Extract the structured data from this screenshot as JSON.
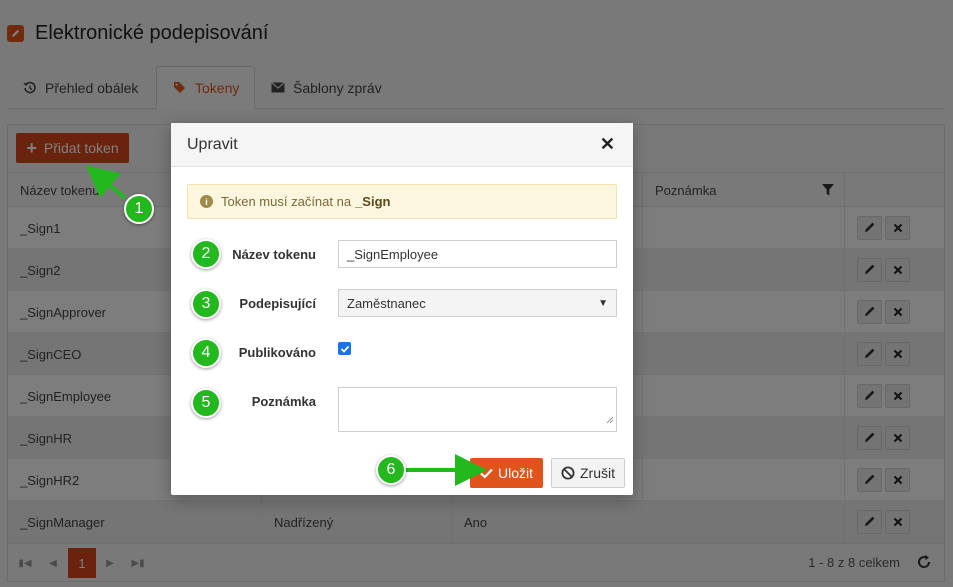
{
  "app": {
    "title": "Elektronické podepisování",
    "icon": "edit-square-icon"
  },
  "tabs": [
    {
      "label": "Přehled obálek",
      "icon": "history-icon"
    },
    {
      "label": "Tokeny",
      "icon": "tags-icon",
      "active": true
    },
    {
      "label": "Šablony zpráv",
      "icon": "envelope-icon"
    }
  ],
  "toolbar": {
    "add_label": "Přidat token"
  },
  "grid": {
    "columns": [
      "Název tokenu",
      "",
      "",
      "Poznámka",
      ""
    ],
    "rows": [
      {
        "name": "_Sign1",
        "signer": "",
        "published": "",
        "note": ""
      },
      {
        "name": "_Sign2",
        "signer": "",
        "published": "",
        "note": ""
      },
      {
        "name": "_SignApprover",
        "signer": "",
        "published": "",
        "note": ""
      },
      {
        "name": "_SignCEO",
        "signer": "",
        "published": "",
        "note": ""
      },
      {
        "name": "_SignEmployee",
        "signer": "",
        "published": "",
        "note": ""
      },
      {
        "name": "_SignHR",
        "signer": "",
        "published": "",
        "note": ""
      },
      {
        "name": "_SignHR2",
        "signer": "",
        "published": "",
        "note": ""
      },
      {
        "name": "_SignManager",
        "signer": "Nadřízený",
        "published": "Ano",
        "note": ""
      }
    ]
  },
  "pager": {
    "current_page": "1",
    "info": "1 - 8 z 8 celkem"
  },
  "modal": {
    "title": "Upravit",
    "alert_text": "Token musí začínat na",
    "alert_bold": "_Sign",
    "fields": {
      "name_label": "Název tokenu",
      "name_value": "_SignEmployee",
      "signer_label": "Podepisující",
      "signer_value": "Zaměstnanec",
      "published_label": "Publikováno",
      "published_checked": true,
      "note_label": "Poznámka",
      "note_value": ""
    },
    "save_label": "Uložit",
    "cancel_label": "Zrušit"
  },
  "annotations": [
    "1",
    "2",
    "3",
    "4",
    "5",
    "6"
  ],
  "colors": {
    "accent": "#e0541b",
    "annotation": "#22b81e"
  }
}
